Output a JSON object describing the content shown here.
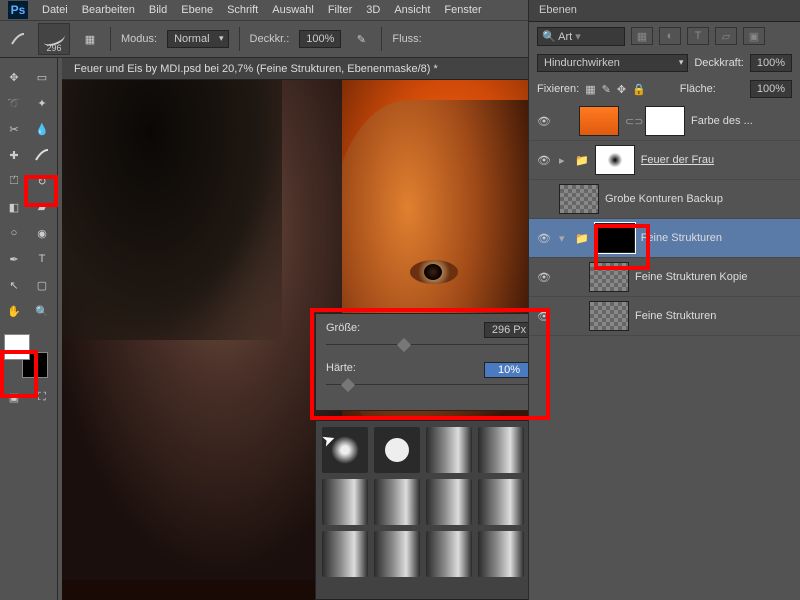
{
  "menu": {
    "items": [
      "Datei",
      "Bearbeiten",
      "Bild",
      "Ebene",
      "Schrift",
      "Auswahl",
      "Filter",
      "3D",
      "Ansicht",
      "Fenster"
    ]
  },
  "optbar": {
    "brush_size": "296",
    "modus_label": "Modus:",
    "modus_value": "Normal",
    "deckkr_label": "Deckkr.:",
    "deckkr_value": "100%",
    "fluss_label": "Fluss:"
  },
  "tab": {
    "title": "Feuer und Eis by MDI.psd bei 20,7% (Feine Strukturen, Ebenenmaske/8) *"
  },
  "brush_popup": {
    "size_label": "Größe:",
    "size_value": "296 Px",
    "hard_label": "Härte:",
    "hard_value": "10%"
  },
  "panel": {
    "tab": "Ebenen",
    "search_placeholder": "Art",
    "blend_value": "Hindurchwirken",
    "opacity_label": "Deckkraft:",
    "opacity_value": "100%",
    "lock_label": "Fixieren:",
    "fill_label": "Fläche:",
    "fill_value": "100%",
    "layers": [
      {
        "name": "Farbe des ...",
        "type": "fill-orange"
      },
      {
        "name": "Feuer der Frau",
        "type": "group",
        "underline": true
      },
      {
        "name": "Grobe Konturen Backup",
        "type": "pixel"
      },
      {
        "name": "Feine Strukturen",
        "type": "group-masked",
        "selected": true
      },
      {
        "name": "Feine Strukturen Kopie",
        "type": "pixel"
      },
      {
        "name": "Feine Strukturen",
        "type": "pixel"
      }
    ]
  }
}
